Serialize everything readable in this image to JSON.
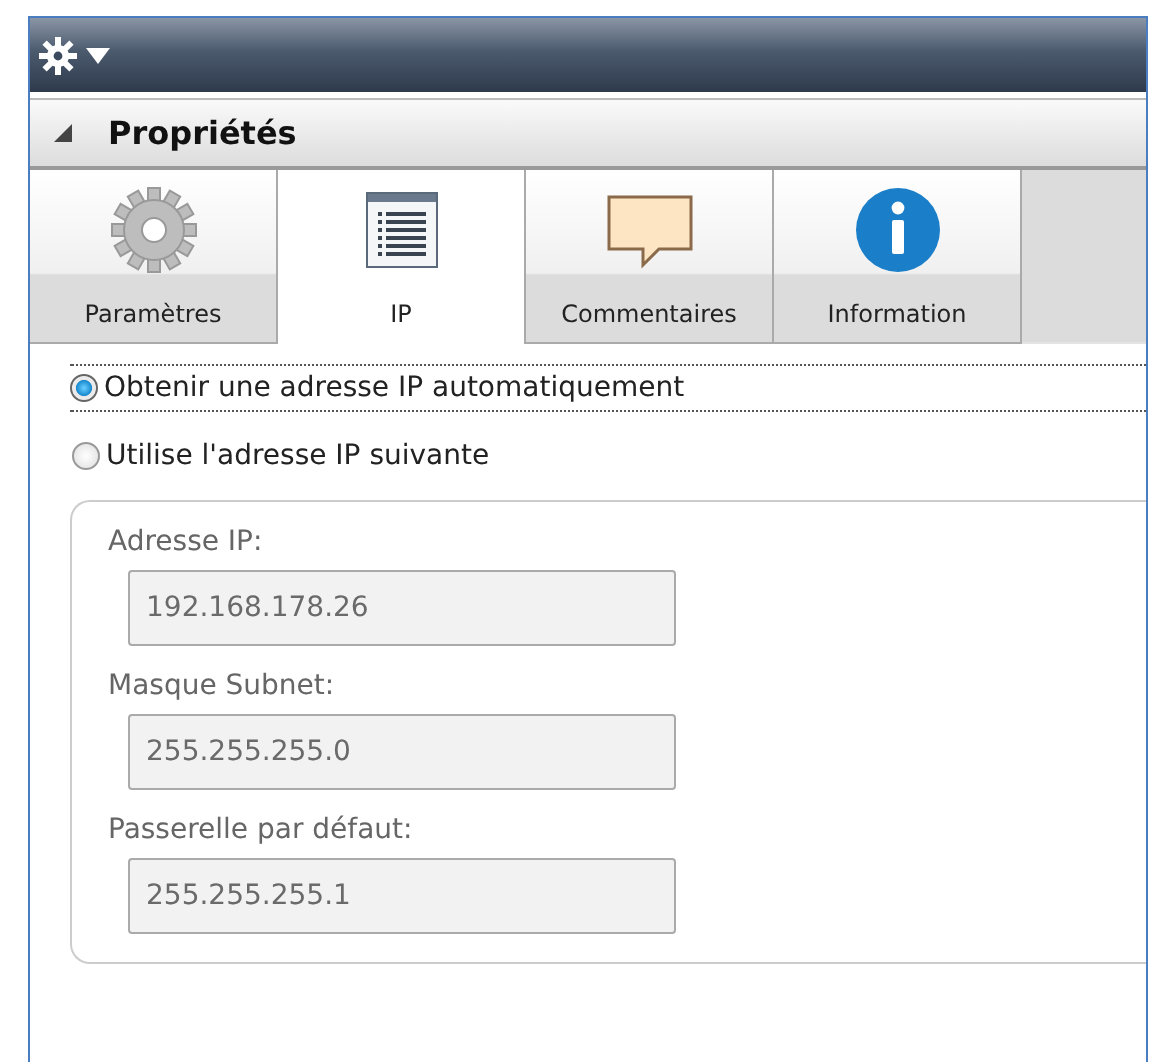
{
  "panel": {
    "title": "Propriétés",
    "expanded": true
  },
  "tabs": [
    {
      "label": "Paramètres",
      "kind": "gear",
      "selected": false
    },
    {
      "label": "IP",
      "kind": "list",
      "selected": true
    },
    {
      "label": "Commentaires",
      "kind": "comment",
      "selected": false
    },
    {
      "label": "Information",
      "kind": "info",
      "selected": false
    }
  ],
  "radios": [
    {
      "label": "Obtenir une adresse IP automatiquement",
      "selected": true
    },
    {
      "label": "Utilise l'adresse IP suivante",
      "selected": false
    }
  ],
  "ip_group": {
    "disabled": true,
    "fields": [
      {
        "label": "Adresse IP:",
        "value": "192.168.178.26"
      },
      {
        "label": "Masque Subnet:",
        "value": "255.255.255.0"
      },
      {
        "label": "Passerelle par défaut:",
        "value": "255.255.255.1"
      }
    ]
  }
}
